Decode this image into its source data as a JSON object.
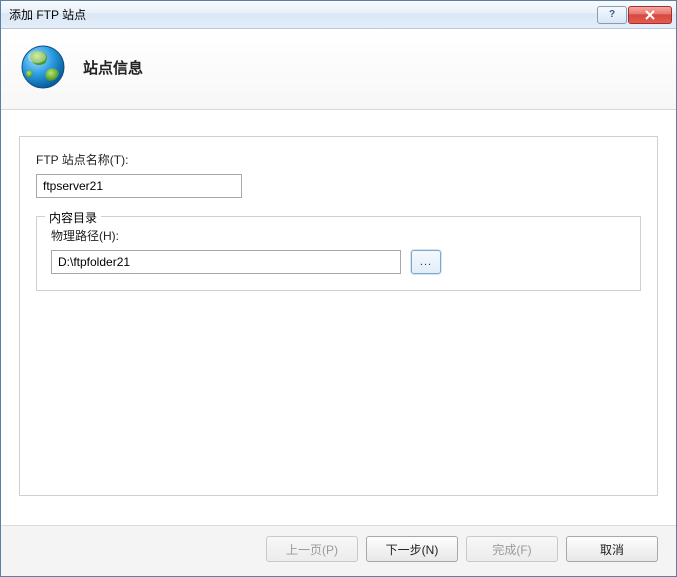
{
  "window": {
    "title": "添加 FTP 站点"
  },
  "header": {
    "title": "站点信息"
  },
  "form": {
    "site_name_label": "FTP 站点名称(T):",
    "site_name_value": "ftpserver21",
    "content_dir_legend": "内容目录",
    "physical_path_label": "物理路径(H):",
    "physical_path_value": "D:\\ftpfolder21",
    "browse_label": "..."
  },
  "buttons": {
    "previous": "上一页(P)",
    "next": "下一步(N)",
    "finish": "完成(F)",
    "cancel": "取消"
  }
}
